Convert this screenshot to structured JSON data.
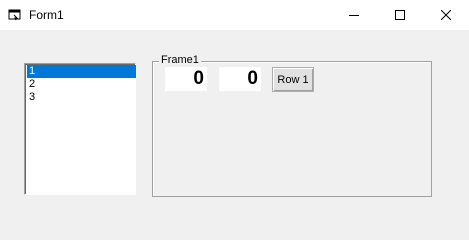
{
  "window": {
    "title": "Form1"
  },
  "icons": {
    "app": "form-window-icon",
    "minimize": "minimize-icon",
    "maximize": "maximize-icon",
    "close": "close-icon"
  },
  "listbox": {
    "items": [
      "1",
      "2",
      "3"
    ],
    "selected_index": 0
  },
  "frame": {
    "label": "Frame1",
    "value_1": "0",
    "value_2": "0",
    "button_label": "Row 1"
  },
  "colors": {
    "selection": "#0078d7",
    "background": "#f0f0f0"
  }
}
